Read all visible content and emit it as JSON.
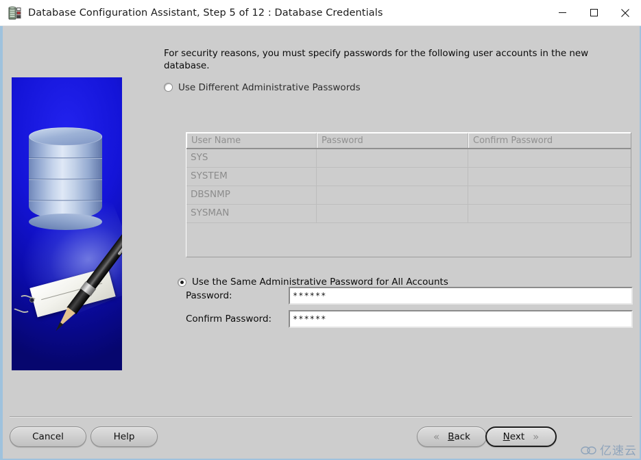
{
  "window": {
    "title": "Database Configuration Assistant, Step 5 of 12 : Database Credentials",
    "icon": "database-app-icon",
    "controls": {
      "minimize": "minimize-icon",
      "maximize": "maximize-icon",
      "close": "close-icon"
    }
  },
  "banner": {
    "alt": "database-cylinder-and-pen-illustration",
    "background_color": "#1414d8"
  },
  "main": {
    "intro": "For security reasons, you must specify passwords for the following user accounts in the new database.",
    "option_different": {
      "label": "Use Different Administrative Passwords",
      "selected": false
    },
    "option_same": {
      "label": "Use the Same Administrative Password for All Accounts",
      "selected": true
    },
    "table": {
      "headers": [
        "User Name",
        "Password",
        "Confirm Password"
      ],
      "rows": [
        {
          "user": "SYS",
          "password": "",
          "confirm": ""
        },
        {
          "user": "SYSTEM",
          "password": "",
          "confirm": ""
        },
        {
          "user": "DBSNMP",
          "password": "",
          "confirm": ""
        },
        {
          "user": "SYSMAN",
          "password": "",
          "confirm": ""
        }
      ],
      "enabled": false
    },
    "password_field": {
      "label": "Password:",
      "value": "******",
      "placeholder": ""
    },
    "confirm_field": {
      "label": "Confirm Password:",
      "value": "******",
      "placeholder": ""
    }
  },
  "buttons": {
    "cancel": "Cancel",
    "help": "Help",
    "back": {
      "mnemonic": "B",
      "rest": "ack",
      "chevron": "«"
    },
    "next": {
      "mnemonic": "N",
      "rest": "ext",
      "chevron": "»"
    }
  },
  "watermark": {
    "text": "亿速云",
    "icon": "cloud-icon"
  }
}
